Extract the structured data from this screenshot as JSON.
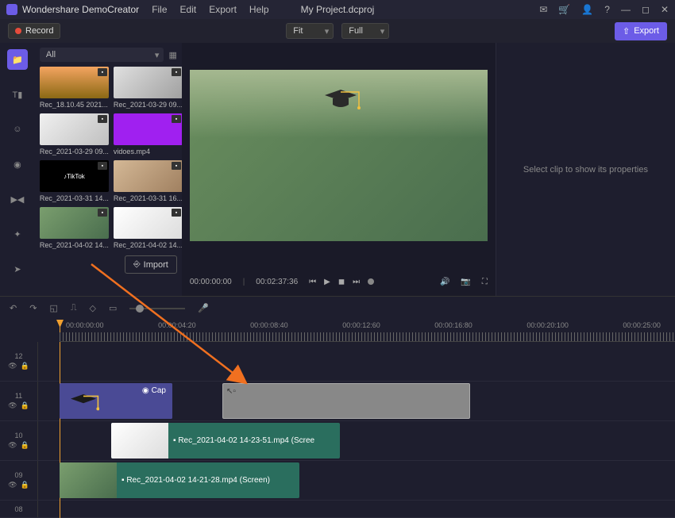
{
  "app": {
    "title": "Wondershare DemoCreator",
    "project": "My Project.dcproj"
  },
  "menu": [
    "File",
    "Edit",
    "Export",
    "Help"
  ],
  "toolbar": {
    "record": "Record",
    "fit": "Fit",
    "full": "Full",
    "export": "Export"
  },
  "media": {
    "filter": "All",
    "items": [
      {
        "label": "Rec_18.10.45 2021..."
      },
      {
        "label": "Rec_2021-03-29 09..."
      },
      {
        "label": "Rec_2021-03-29 09..."
      },
      {
        "label": "vidoes.mp4"
      },
      {
        "label": "Rec_2021-03-31 14..."
      },
      {
        "label": "Rec_2021-03-31 16..."
      },
      {
        "label": "Rec_2021-04-02 14..."
      },
      {
        "label": "Rec_2021-04-02 14..."
      }
    ],
    "import": "Import"
  },
  "preview": {
    "time_current": "00:00:00:00",
    "time_total": "00:02:37:36"
  },
  "props": {
    "empty": "Select clip to show its properties"
  },
  "ruler": [
    "00:00:00:00",
    "00:00:04:20",
    "00:00:08:40",
    "00:00:12:60",
    "00:00:16:80",
    "00:00:20:100",
    "00:00:25:00"
  ],
  "tracks": {
    "t12": "12",
    "t11": "11",
    "t10": "10",
    "t09": "09",
    "t08": "08"
  },
  "clips": {
    "cap": "Cap",
    "v2": "Rec_2021-04-02 14-23-51.mp4 (Scree",
    "v1": "Rec_2021-04-02 14-21-28.mp4 (Screen)"
  }
}
